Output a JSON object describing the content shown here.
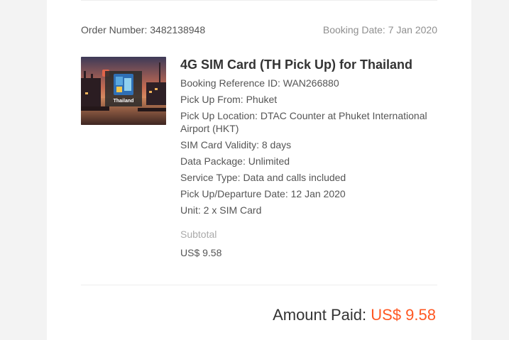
{
  "order": {
    "order_number": "Order Number: 3482138948",
    "booking_date": "Booking Date: 7 Jan 2020"
  },
  "product": {
    "thumbnail_caption": "Thailand",
    "title": "4G SIM Card (TH Pick Up) for Thailand",
    "details": [
      "Booking Reference ID: WAN266880",
      "Pick Up From: Phuket",
      "Pick Up Location: DTAC Counter at Phuket International Airport (HKT)",
      "SIM Card Validity: 8 days",
      "Data Package: Unlimited",
      "Service Type: Data and calls included",
      "Pick Up/Departure Date: 12 Jan 2020",
      "Unit: 2 x SIM Card"
    ],
    "subtotal_label": "Subtotal",
    "subtotal_value": "US$ 9.58"
  },
  "payment": {
    "label": "Amount Paid:",
    "value": "US$ 9.58"
  },
  "colors": {
    "accent": "#ff5722",
    "page_background": "#f3f3f3",
    "card_background": "#ffffff"
  }
}
